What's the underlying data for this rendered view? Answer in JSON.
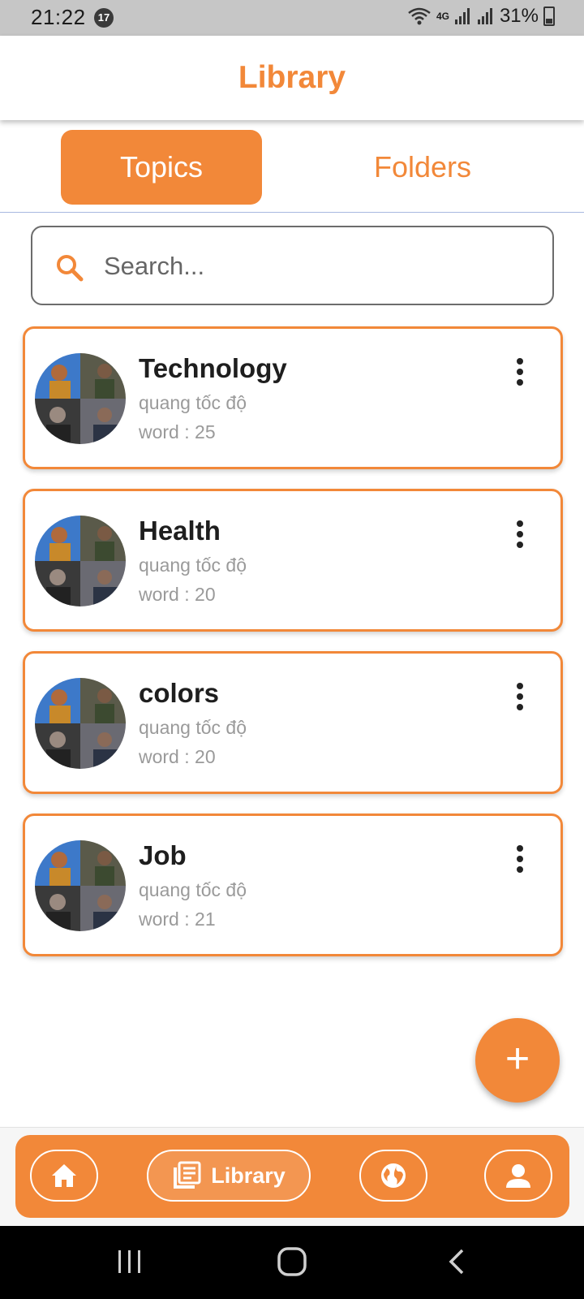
{
  "status_bar": {
    "time": "21:22",
    "notification_count": "17",
    "network": "4G",
    "battery": "31%"
  },
  "app_bar": {
    "title": "Library"
  },
  "tabs": [
    {
      "label": "Topics",
      "selected": true
    },
    {
      "label": "Folders",
      "selected": false
    }
  ],
  "search": {
    "placeholder": "Search...",
    "value": ""
  },
  "topics": [
    {
      "title": "Technology",
      "author": "quang tốc độ",
      "count": "word : 25"
    },
    {
      "title": "Health",
      "author": "quang tốc độ",
      "count": "word : 20"
    },
    {
      "title": "colors",
      "author": "quang tốc độ",
      "count": "word : 20"
    },
    {
      "title": "Job",
      "author": "quang tốc độ",
      "count": "word : 21"
    }
  ],
  "fab": {
    "icon": "plus-icon",
    "label": "+"
  },
  "bottom_nav": {
    "items": [
      {
        "icon": "home-icon"
      },
      {
        "icon": "library-icon",
        "label": "Library",
        "selected": true
      },
      {
        "icon": "globe-icon"
      },
      {
        "icon": "profile-icon"
      }
    ]
  },
  "colors": {
    "accent": "#f28839",
    "text_primary": "#1e1e1e",
    "text_secondary": "#9a9a9a"
  }
}
